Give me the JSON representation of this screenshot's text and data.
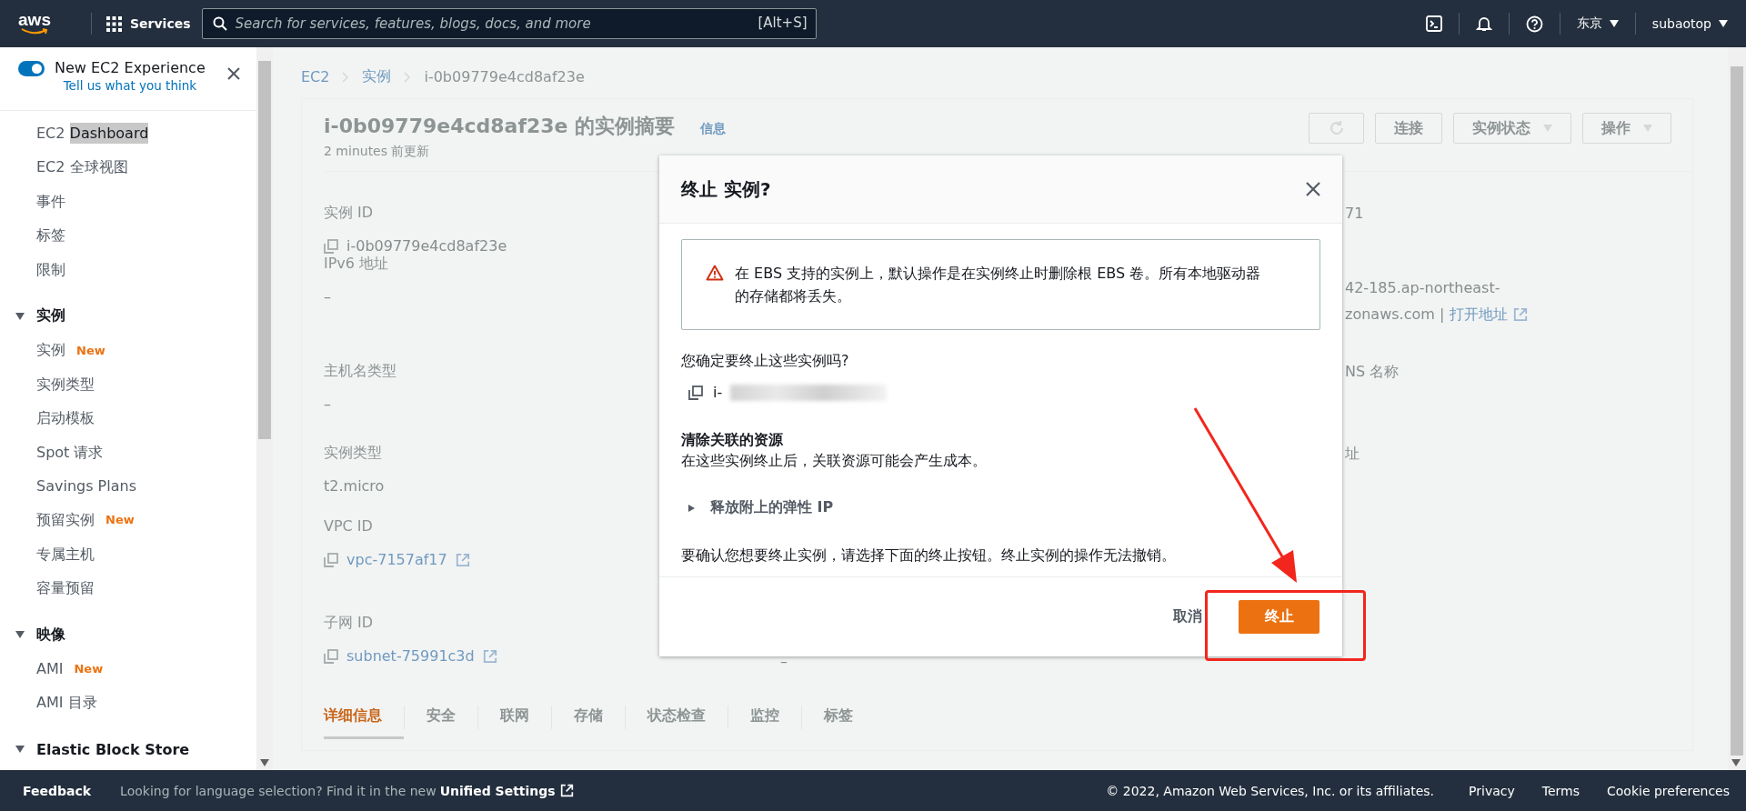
{
  "top_bar": {
    "logo": "aws",
    "services_label": "Services",
    "search": {
      "placeholder": "Search for services, features, blogs, docs, and more",
      "shortcut": "[Alt+S]"
    },
    "region": "东京",
    "account": "subaotop"
  },
  "sidebar": {
    "experience_toggle": {
      "label": "New EC2 Experience",
      "on": true,
      "link": "Tell us what you think"
    },
    "items": [
      {
        "label": "EC2",
        "highlighted_text": "Dashboard"
      },
      {
        "label": "EC2 全球视图"
      },
      {
        "label": "事件"
      },
      {
        "label": "标签"
      },
      {
        "label": "限制"
      }
    ],
    "sections": [
      {
        "title": "实例",
        "expanded": true,
        "items": [
          {
            "label": "实例",
            "badge": "New"
          },
          {
            "label": "实例类型"
          },
          {
            "label": "启动模板"
          },
          {
            "label": "Spot 请求"
          },
          {
            "label": "Savings Plans"
          },
          {
            "label": "预留实例",
            "badge": "New"
          },
          {
            "label": "专属主机"
          },
          {
            "label": "容量预留"
          }
        ]
      },
      {
        "title": "映像",
        "expanded": true,
        "items": [
          {
            "label": "AMI",
            "badge": "New"
          },
          {
            "label": "AMI 目录"
          }
        ]
      },
      {
        "title": "Elastic Block Store",
        "expanded": true
      }
    ]
  },
  "breadcrumb": [
    "EC2",
    "实例",
    "i-0b09779e4cd8af23e"
  ],
  "summary": {
    "title": "i-0b09779e4cd8af23e 的实例摘要",
    "info_link": "信息",
    "updated": "2 minutes 前更新",
    "buttons": [
      {
        "kind": "refresh"
      },
      {
        "kind": "text",
        "label": "连接"
      },
      {
        "kind": "dropdown",
        "label": "实例状态"
      },
      {
        "kind": "dropdown",
        "label": "操作"
      }
    ],
    "rows": [
      {
        "left": {
          "label": "实例 ID",
          "value": "i-0b09779e4cd8af23e",
          "copy": true
        },
        "right": {
          "lines": [
            "71"
          ]
        }
      },
      {
        "left": {
          "label": "IPv6 地址",
          "value": "–"
        },
        "right": {
          "lines": [
            "42-185.ap-northeast-",
            "zonaws.com |"
          ],
          "link": "打开地址"
        }
      },
      {
        "left": {
          "label": "主机名类型",
          "value": "–"
        },
        "right": {
          "lines": [
            "NS 名称"
          ]
        }
      },
      {
        "left": {
          "label": "实例类型",
          "value": "t2.micro"
        },
        "right": {
          "lines": [
            "址"
          ]
        }
      },
      {
        "left": {
          "label": "VPC ID",
          "value": "vpc-7157af17",
          "copy": true,
          "link": true
        }
      },
      {
        "left": {
          "label": "子网 ID",
          "value": "subnet-75991c3d",
          "copy": true,
          "link": true
        },
        "middle": {
          "value": "–"
        }
      }
    ],
    "tabs": [
      {
        "label": "详细信息",
        "selected": true
      },
      {
        "label": "安全",
        "selected": false
      },
      {
        "label": "联网",
        "selected": false
      },
      {
        "label": "存储",
        "selected": false
      },
      {
        "label": "状态检查",
        "selected": false
      },
      {
        "label": "监控",
        "selected": false
      },
      {
        "label": "标签",
        "selected": false
      }
    ]
  },
  "modal": {
    "title": "终止 实例?",
    "alert": {
      "kind": "warning",
      "text": "在 EBS 支持的实例上，默认操作是在实例终止时删除根 EBS 卷。所有本地驱动器的存储都将丢失。"
    },
    "question": "您确定要终止这些实例吗?",
    "instance_id": "i-",
    "redacted": true,
    "resources_heading": "清除关联的资源",
    "resources_text": "在这些实例终止后，关联资源可能会产生成本。",
    "expander": {
      "label": "释放附上的弹性 IP",
      "expanded": false
    },
    "confirm_text": "要确认您想要终止实例，请选择下面的终止按钮。终止实例的操作无法撤销。",
    "buttons": [
      {
        "kind": "link",
        "label": "取消"
      },
      {
        "kind": "primary",
        "label": "终止"
      }
    ]
  },
  "footer": {
    "feedback": "Feedback",
    "language_note": "Looking for language selection? Find it in the new",
    "settings_link": "Unified Settings",
    "copyright": "© 2022, Amazon Web Services, Inc. or its affiliates.",
    "links": [
      "Privacy",
      "Terms",
      "Cookie preferences"
    ]
  }
}
